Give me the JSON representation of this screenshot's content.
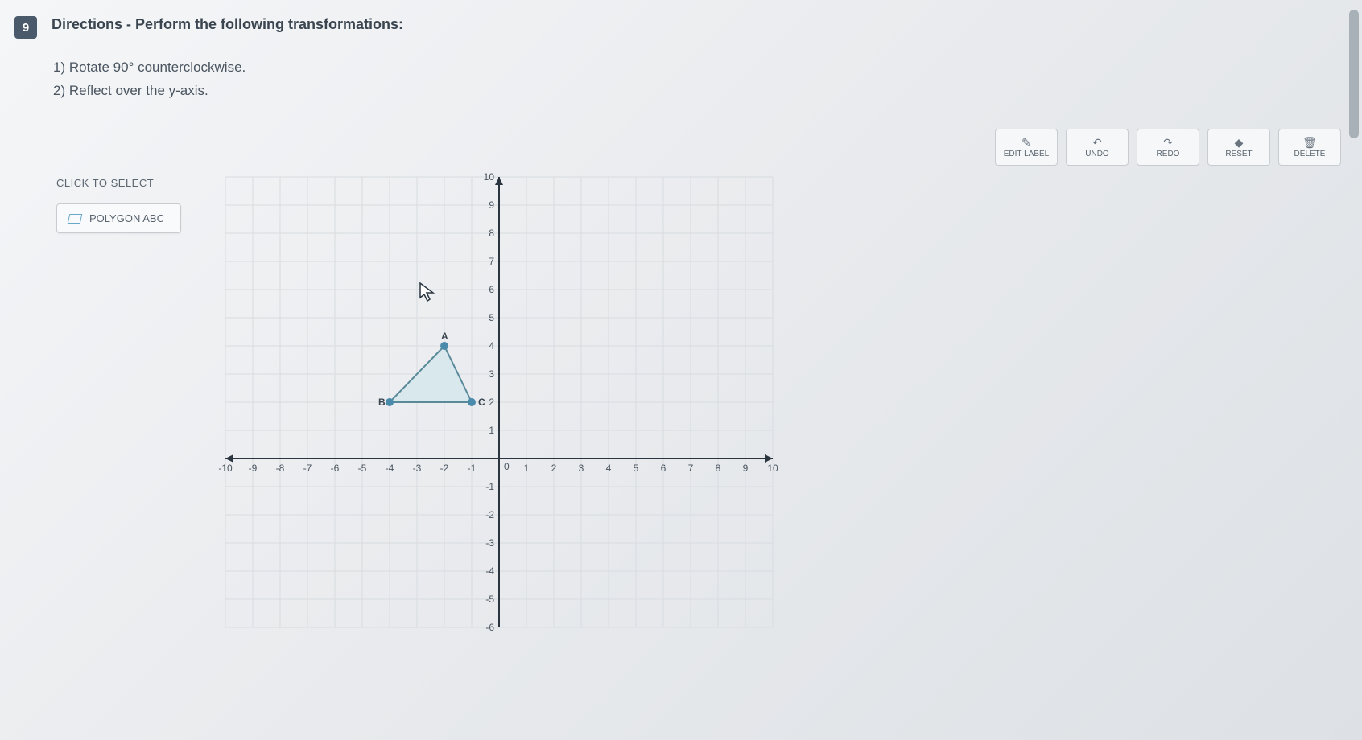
{
  "question": {
    "number": "9",
    "directions_label": "Directions - Perform the following transformations:",
    "step1_prefix": "1) Rotate ",
    "step1_angle": "90°",
    "step1_suffix": " counterclockwise.",
    "step2": "2) Reflect over the y-axis."
  },
  "toolbar": {
    "edit_label": "EDIT LABEL",
    "undo": "UNDO",
    "redo": "REDO",
    "reset": "RESET",
    "delete": "DELETE"
  },
  "selector": {
    "title": "CLICK TO SELECT",
    "polygon_label": "POLYGON ABC"
  },
  "chart_data": {
    "type": "scatter",
    "title": "",
    "xlabel": "",
    "ylabel": "",
    "xlim": [
      -10,
      10
    ],
    "ylim": [
      -6,
      10
    ],
    "x_ticks": [
      -10,
      -9,
      -8,
      -7,
      -6,
      -5,
      -4,
      -3,
      -2,
      -1,
      0,
      1,
      2,
      3,
      4,
      5,
      6,
      7,
      8,
      9,
      10
    ],
    "y_ticks": [
      -6,
      -5,
      -4,
      -3,
      -2,
      -1,
      0,
      1,
      2,
      3,
      4,
      5,
      6,
      7,
      8,
      9,
      10
    ],
    "polygon": {
      "name": "ABC",
      "vertices": [
        {
          "label": "A",
          "x": -2,
          "y": 4
        },
        {
          "label": "B",
          "x": -4,
          "y": 2
        },
        {
          "label": "C",
          "x": -1,
          "y": 2
        }
      ]
    }
  }
}
